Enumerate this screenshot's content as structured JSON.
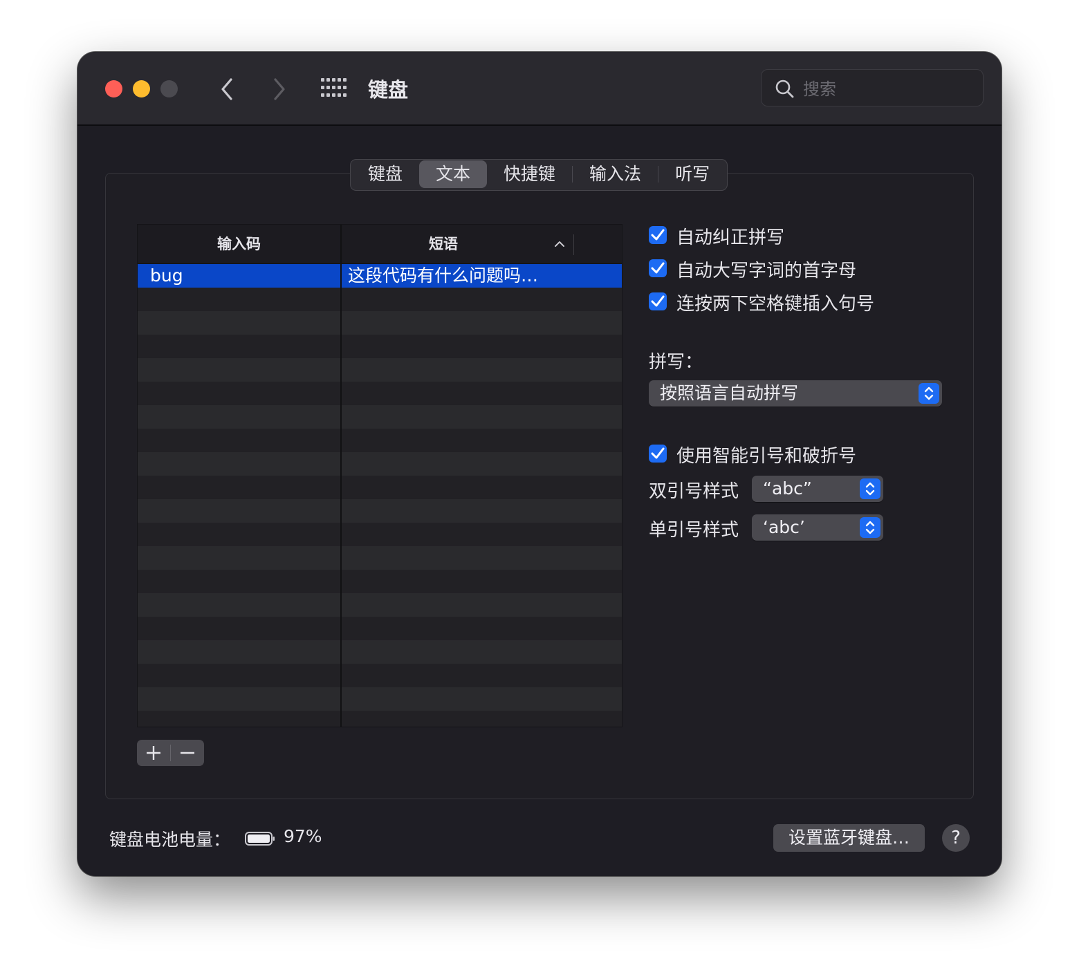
{
  "window": {
    "title": "键盘",
    "search_placeholder": "搜索"
  },
  "tabs": [
    {
      "label": "键盘",
      "selected": false
    },
    {
      "label": "文本",
      "selected": true
    },
    {
      "label": "快捷键",
      "selected": false
    },
    {
      "label": "输入法",
      "selected": false
    },
    {
      "label": "听写",
      "selected": false
    }
  ],
  "table": {
    "columns": [
      "输入码",
      "短语"
    ],
    "rows": [
      {
        "code": "bug",
        "phrase": "这段代码有什么问题吗…",
        "selected": true
      }
    ]
  },
  "options": {
    "auto_correct": {
      "label": "自动纠正拼写",
      "checked": true
    },
    "auto_capitalize": {
      "label": "自动大写字词的首字母",
      "checked": true
    },
    "double_space_period": {
      "label": "连按两下空格键插入句号",
      "checked": true
    },
    "spelling_label": "拼写：",
    "spelling_value": "按照语言自动拼写",
    "smart_quotes": {
      "label": "使用智能引号和破折号",
      "checked": true
    },
    "double_quote_label": "双引号样式",
    "double_quote_value": "“abc”",
    "single_quote_label": "单引号样式",
    "single_quote_value": "‘abc’"
  },
  "footer": {
    "battery_label": "键盘电池电量：",
    "battery_value": "97%",
    "bluetooth_button": "设置蓝牙键盘…",
    "help_button": "?"
  },
  "colors": {
    "accent": "#1d6bf3",
    "selection": "#0a47c8",
    "close": "#fe5f57",
    "minimize": "#febc2e"
  }
}
